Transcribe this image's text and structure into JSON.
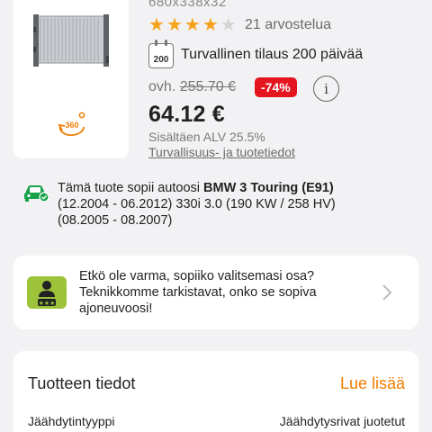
{
  "product": {
    "code": "680x338x32",
    "rating": 4,
    "rating_max": 5,
    "reviews": "21 arvostelua",
    "delivery_days": "200",
    "delivery_text": "Turvallinen tilaus 200 päivää",
    "old_price_prefix": "ovh.",
    "old_price": "255.70 €",
    "discount": "-74%",
    "price": "64.12 €",
    "vat": "Sisältäen ALV 25.5%",
    "safety_link": "Turvallisuus- ja tuotetiedot",
    "rotate_label": "360"
  },
  "compatibility": {
    "prefix": "Tämä tuote sopii autoosi ",
    "car": "BMW 3 Touring (E91)",
    "line2": "(12.2004 - 06.2012) 330i 3.0 (190 KW / 258 HV)",
    "line3": "(08.2005 - 08.2007)"
  },
  "help": {
    "text": "Etkö ole varma, sopiiko valitsemasi osa? Teknikkomme tarkistavat, onko se sopiva ajoneuvoosi!"
  },
  "details": {
    "title": "Tuotteen tiedot",
    "read_more": "Lue lisää",
    "spec_label": "Jäähdytintyyppi",
    "spec_value": "Jäähdytysrivat juotetut"
  },
  "colors": {
    "accent": "#f07d00",
    "star": "#f6a21a",
    "discount": "#e4151f",
    "tech_green": "#9dc33b",
    "car_green": "#17a24a"
  }
}
